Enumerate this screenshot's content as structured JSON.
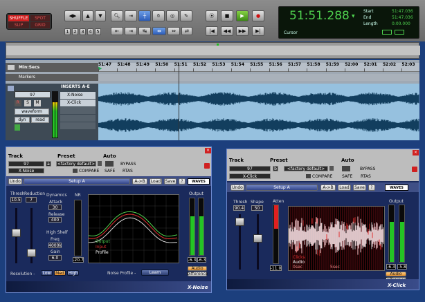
{
  "edit_modes": {
    "shuffle": "SHUFFLE",
    "spot": "SPOT",
    "slip": "SLIP",
    "grid": "GRID"
  },
  "zoom_presets": [
    "1",
    "2",
    "3",
    "4",
    "5"
  ],
  "transport": {
    "main_counter": "51:51.288",
    "start_label": "Start",
    "end_label": "End",
    "length_label": "Length",
    "start": "51:47.036",
    "end": "51:47.036",
    "length": "0:00.000",
    "cursor_label": "Cursor"
  },
  "ruler": {
    "title": "Min:Secs",
    "markers_label": "Markers",
    "ticks": [
      "51:47",
      "51:48",
      "51:49",
      "51:50",
      "51:51",
      "51:52",
      "51:53",
      "51:54",
      "51:55",
      "51:56",
      "51:57",
      "51:58",
      "51:59",
      "52:00",
      "52:01",
      "52:02",
      "52:03"
    ]
  },
  "track": {
    "name": "97",
    "rec": "R",
    "solo": "S",
    "mute": "M",
    "view": "waveform",
    "dyn": "dyn",
    "read": "read",
    "inserts_label": "INSERTS A-E",
    "inserts": [
      "X-Noise",
      "X-Click"
    ]
  },
  "xnoise": {
    "track_label": "Track",
    "preset_label": "Preset",
    "auto_label": "Auto",
    "track_name": "97",
    "track_suffix": "a",
    "plugin_name": "X-Noise",
    "preset": "<factory default>",
    "compare": "COMPARE",
    "bypass": "BYPASS",
    "safe": "SAFE",
    "rtas": "RTAS",
    "undo": "Undo",
    "setup": "Setup A",
    "ab": "A->B",
    "load": "Load",
    "save": "Save",
    "help": "?",
    "brand": "WAVES",
    "thresh_label": "Thresh",
    "thresh": "10.5",
    "reduction_label": "Reduction",
    "reduction": "7",
    "dynamics_label": "Dynamics",
    "attack_label": "Attack",
    "attack": "30",
    "release_label": "Release",
    "release": "400",
    "highshelf_label": "High Shelf",
    "freq_label": "Freq",
    "freq": "4000k",
    "gain_label": "Gain",
    "gain": "6.0",
    "nr_label": "NR",
    "nr": "-20.7",
    "output_label": "Output",
    "out_l": "-6.3",
    "out_r": "-6.3",
    "resolution_label": "Resolution -",
    "res_low": "Low",
    "res_med": "Med",
    "res_high": "High",
    "noise_profile": "Noise Profile -",
    "learn": "Learn",
    "legend": [
      "Output",
      "Input",
      "Profile"
    ],
    "audio": "Audio",
    "difference": "Difference",
    "title": "X-Noise"
  },
  "xclick": {
    "track_label": "Track",
    "preset_label": "Preset",
    "auto_label": "Auto",
    "track_name": "97",
    "track_suffix": "b",
    "plugin_name": "X-Click",
    "preset": "<factory default>",
    "compare": "COMPARE",
    "bypass": "BYPASS",
    "safe": "SAFE",
    "rtas": "RTAS",
    "undo": "Undo",
    "setup": "Setup A",
    "ab": "A->B",
    "load": "Load",
    "save": "Save",
    "help": "?",
    "brand": "WAVES",
    "thresh_label": "Thresh",
    "thresh": "90.4",
    "shape_label": "Shape",
    "shape": "50",
    "atten_label": "Atten",
    "atten": "-11.0",
    "legend": [
      "Clicks",
      "Audio"
    ],
    "time_start": "0sec",
    "time_end": "5sec",
    "output_label": "Output",
    "out_l": "-6.3",
    "out_r": "-5.8",
    "audio": "Audio",
    "difference": "Difference",
    "title": "X-Click"
  },
  "colors": {
    "accent_green": "#4fd24f",
    "bg_blue": "#1c3f7d",
    "waveform": "#0d3e5c"
  }
}
